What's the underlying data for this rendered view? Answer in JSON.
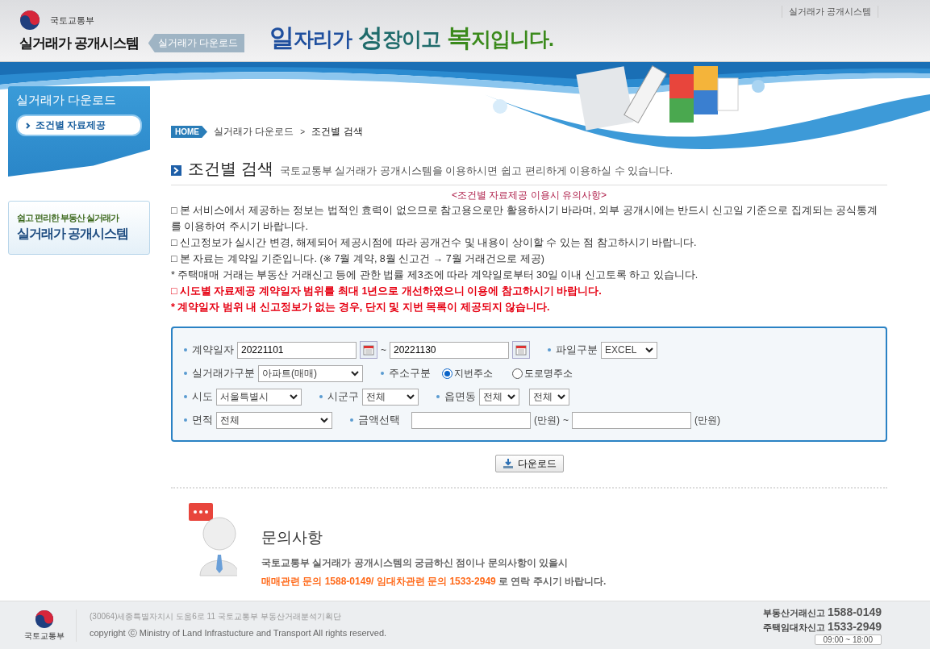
{
  "header": {
    "ministry": "국토교통부",
    "system": "실거래가 공개시스템",
    "section_tag": "실거래가 다운로드",
    "top_link": "실거래가 공개시스템",
    "slogan": [
      {
        "text": "일자리가",
        "color": "#1f4f9e"
      },
      {
        "text": "성장이고",
        "color": "#1f6b6b"
      },
      {
        "text": "복지입니다.",
        "color": "#3b8a1c"
      }
    ]
  },
  "sidebar": {
    "title": "실거래가 다운로드",
    "items": [
      {
        "label": "조건별 자료제공",
        "selected": true
      }
    ],
    "promo": {
      "subtitle": "쉽고 편리한 부동산 실거래가",
      "title": "실거래가 공개시스템"
    }
  },
  "breadcrumb": {
    "home": "HOME",
    "separator": ">",
    "items": [
      "실거래가 다운로드",
      "조건별 검색"
    ]
  },
  "page": {
    "title": "조건별 검색",
    "description": "국토교통부 실거래가 공개시스템을 이용하시면 쉽고 편리하게 이용하실 수 있습니다."
  },
  "notice": {
    "heading": "<조건별 자료제공 이용시 유의사항>",
    "lines": [
      {
        "kind": "normal",
        "text": "□ 본 서비스에서 제공하는 정보는 법적인 효력이 없으므로 참고용으로만 활용하시기 바라며, 외부 공개시에는 반드시 신고일 기준으로 집계되는 공식통계를 이용하여 주시기 바랍니다."
      },
      {
        "kind": "normal",
        "text": "□ 신고정보가 실시간 변경, 해제되어 제공시점에 따라 공개건수 및 내용이 상이할 수 있는 점 참고하시기 바랍니다."
      },
      {
        "kind": "normal",
        "text": "□ 본 자료는 계약일 기준입니다. (※ 7월 계약, 8월 신고건 → 7월 거래건으로 제공)"
      },
      {
        "kind": "normal",
        "text": "* 주택매매 거래는 부동산 거래신고 등에 관한 법률 제3조에 따라 계약일로부터 30일 이내 신고토록 하고 있습니다."
      },
      {
        "kind": "warning",
        "text": "□ 시도별 자료제공 계약일자 범위를 최대 1년으로 개선하였으니 이용에 참고하시기 바랍니다."
      },
      {
        "kind": "warning",
        "text": "* 계약일자 범위 내 신고정보가 없는 경우, 단지 및 지번 목록이 제공되지 않습니다."
      }
    ]
  },
  "search_form": {
    "rows": [
      [
        {
          "kind": "date_range",
          "label": "계약일자",
          "from": "20221101",
          "separator": "~",
          "to": "20221130"
        },
        {
          "kind": "select",
          "label": "파일구분",
          "value": "EXCEL"
        }
      ],
      [
        {
          "kind": "select",
          "label": "실거래가구분",
          "value": "아파트(매매)"
        },
        {
          "kind": "radio",
          "label": "주소구분",
          "options": [
            {
              "label": "지번주소",
              "selected": true
            },
            {
              "label": "도로명주소",
              "selected": false
            }
          ]
        }
      ],
      [
        {
          "kind": "select",
          "label": "시도",
          "value": "서울특별시"
        },
        {
          "kind": "select",
          "label": "시군구",
          "value": "전체"
        },
        {
          "kind": "selects",
          "label": "읍면동",
          "values": [
            "전체",
            "전체"
          ]
        }
      ],
      [
        {
          "kind": "select",
          "label": "면적",
          "value": "전체"
        },
        {
          "kind": "amount_range",
          "label": "금액선택",
          "units": [
            "(만원)",
            "(만원)"
          ],
          "separator": "~"
        }
      ]
    ]
  },
  "download_button": "다운로드",
  "inquiry": {
    "title": "문의사항",
    "text": "국토교통부 실거래가 공개시스템의 궁금하신 점이나 문의사항이 있을시",
    "contact": "**매매관련 문의 1588-0149/ 임대차관련 문의 1533-2949** 로 연락 주시기 바랍니다."
  },
  "footer": {
    "logo_text": "국토교통부",
    "address": "(30064)세종특별자치시 도움6로 11 국토교통부 부동산거래분석기획단",
    "copyright": "copyright ⓒ Ministry of Land Infrastucture and Transport All rights reserved.",
    "phones": [
      {
        "label": "부동산거래신고",
        "number": "1588-0149"
      },
      {
        "label": "주택임대차신고",
        "number": "1533-2949"
      }
    ],
    "hours": "09:00 ~ 18:00"
  }
}
